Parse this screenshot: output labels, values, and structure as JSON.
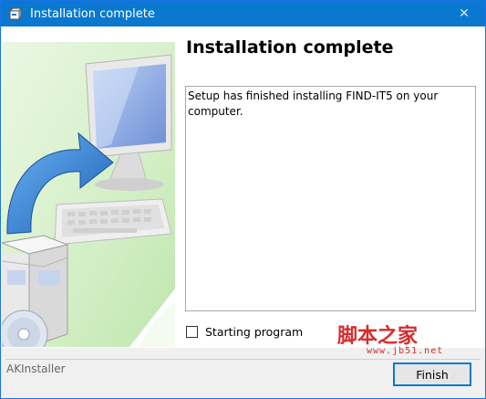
{
  "window": {
    "title": "Installation complete",
    "close_glyph": "✕"
  },
  "page": {
    "heading": "Installation complete",
    "message": "Setup has finished installing FIND-IT5 on your computer.",
    "checkbox_label": "Starting program",
    "checkbox_checked": false
  },
  "footer": {
    "installer_name": "AKInstaller",
    "finish_label": "Finish"
  },
  "watermark": {
    "text": "脚本之家",
    "url": "www.jb51.net"
  },
  "icons": {
    "title": "installer-box-icon",
    "artwork": "computer-install-artwork"
  },
  "colors": {
    "titlebar": "#0b78d0",
    "watermark": "#d52c2c"
  }
}
